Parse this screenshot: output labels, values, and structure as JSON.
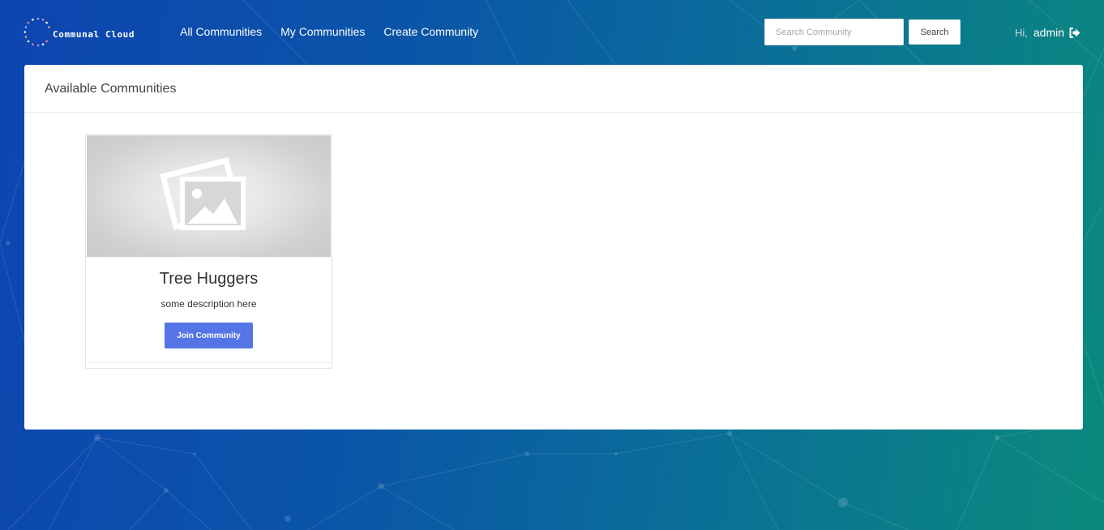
{
  "brand": {
    "name": "Communal Cloud",
    "logo_icon": "dotted-circle-logo"
  },
  "nav": {
    "items": [
      {
        "label": "All Communities"
      },
      {
        "label": "My Communities"
      },
      {
        "label": "Create Community"
      }
    ]
  },
  "search": {
    "placeholder": "Search Community",
    "value": "",
    "button_label": "Search"
  },
  "user": {
    "greeting": "Hi,",
    "name": "admin",
    "logout_icon": "sign-out-icon"
  },
  "main": {
    "title": "Available Communities",
    "communities": [
      {
        "name": "Tree Huggers",
        "description": "some description here",
        "image_icon": "image-placeholder-icon",
        "action_label": "Join Community"
      }
    ]
  },
  "colors": {
    "accent": "#5574e6",
    "background_start": "#0d45b0",
    "background_end": "#0b8a7c"
  }
}
